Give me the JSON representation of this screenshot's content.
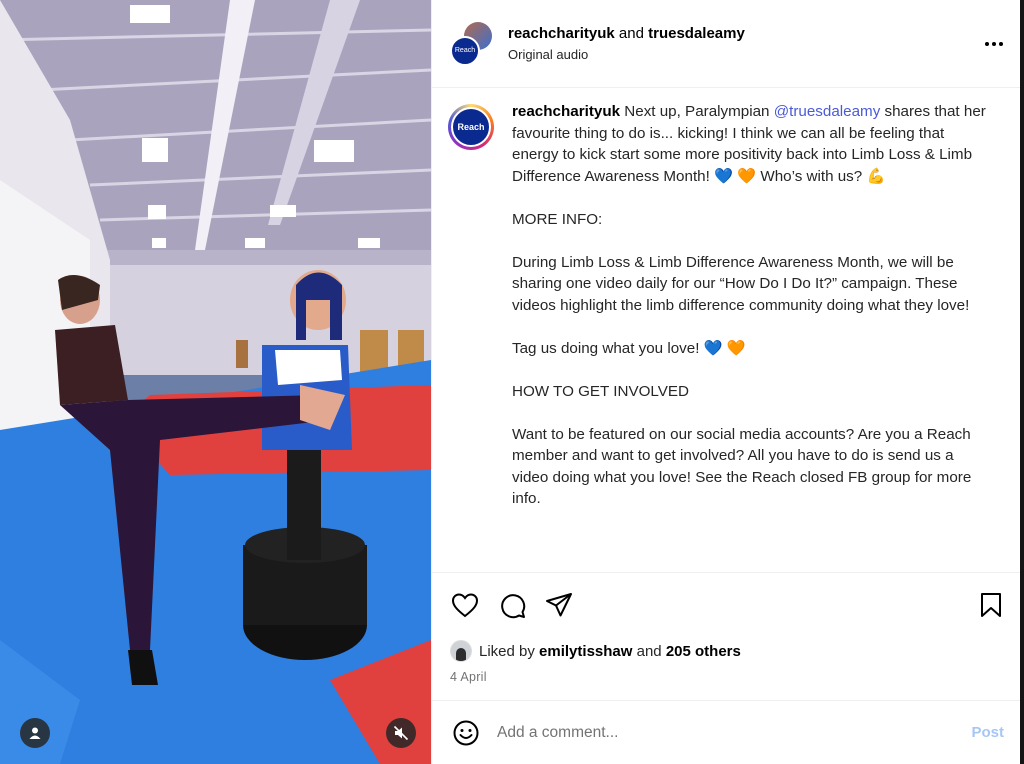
{
  "header": {
    "user1": "reachcharityuk",
    "joiner": "and",
    "user2": "truesdaleamy",
    "subtitle": "Original audio",
    "more_icon": "more-horizontal-icon",
    "avatar_text": "Reach"
  },
  "caption": {
    "avatar_text": "Reach",
    "username": "reachcharityuk",
    "intro": " Next up, Paralympian ",
    "mention": "@truesdaleamy",
    "line1_rest": " shares that her favourite thing to do is... kicking! I think we can all be feeling that energy to kick start some more positivity back into Limb Loss & Limb Difference Awareness Month! ",
    "line1_tail": " Who’s with us? ",
    "more_info_heading": "MORE INFO:",
    "more_info_text": "During Limb Loss & Limb Difference Awareness Month, we will be sharing one video daily for our “How Do I Do It?” campaign. These videos highlight the limb difference community doing what they love!",
    "tag_text": "Tag us doing what you love! ",
    "how_heading": "HOW TO GET INVOLVED",
    "involve_text": "Want to be featured on our social media accounts? Are you a Reach member and want to get involved? All you have to do is send us a video doing what you love! See the Reach closed FB group for more info.",
    "emoji_blue_heart": "💙",
    "emoji_orange_heart": "🧡",
    "emoji_muscle": "💪"
  },
  "actions": {
    "like_icon": "heart-icon",
    "comment_icon": "comment-icon",
    "share_icon": "share-icon",
    "save_icon": "bookmark-icon"
  },
  "likes": {
    "prefix": "Liked by ",
    "user": "emilytisshaw",
    "middle": " and ",
    "others": "205 others"
  },
  "date": "4 April",
  "comment": {
    "placeholder": "Add a comment...",
    "post_label": "Post",
    "emoji_icon": "smiley-icon"
  },
  "media": {
    "tags_icon": "user-tag-icon",
    "mute_icon": "muted-speaker-icon"
  },
  "colors": {
    "mention": "#4a5ad8",
    "post_button": "#a7c6f5",
    "mat_blue": "#2f7fe0",
    "mat_red": "#e0413f"
  }
}
